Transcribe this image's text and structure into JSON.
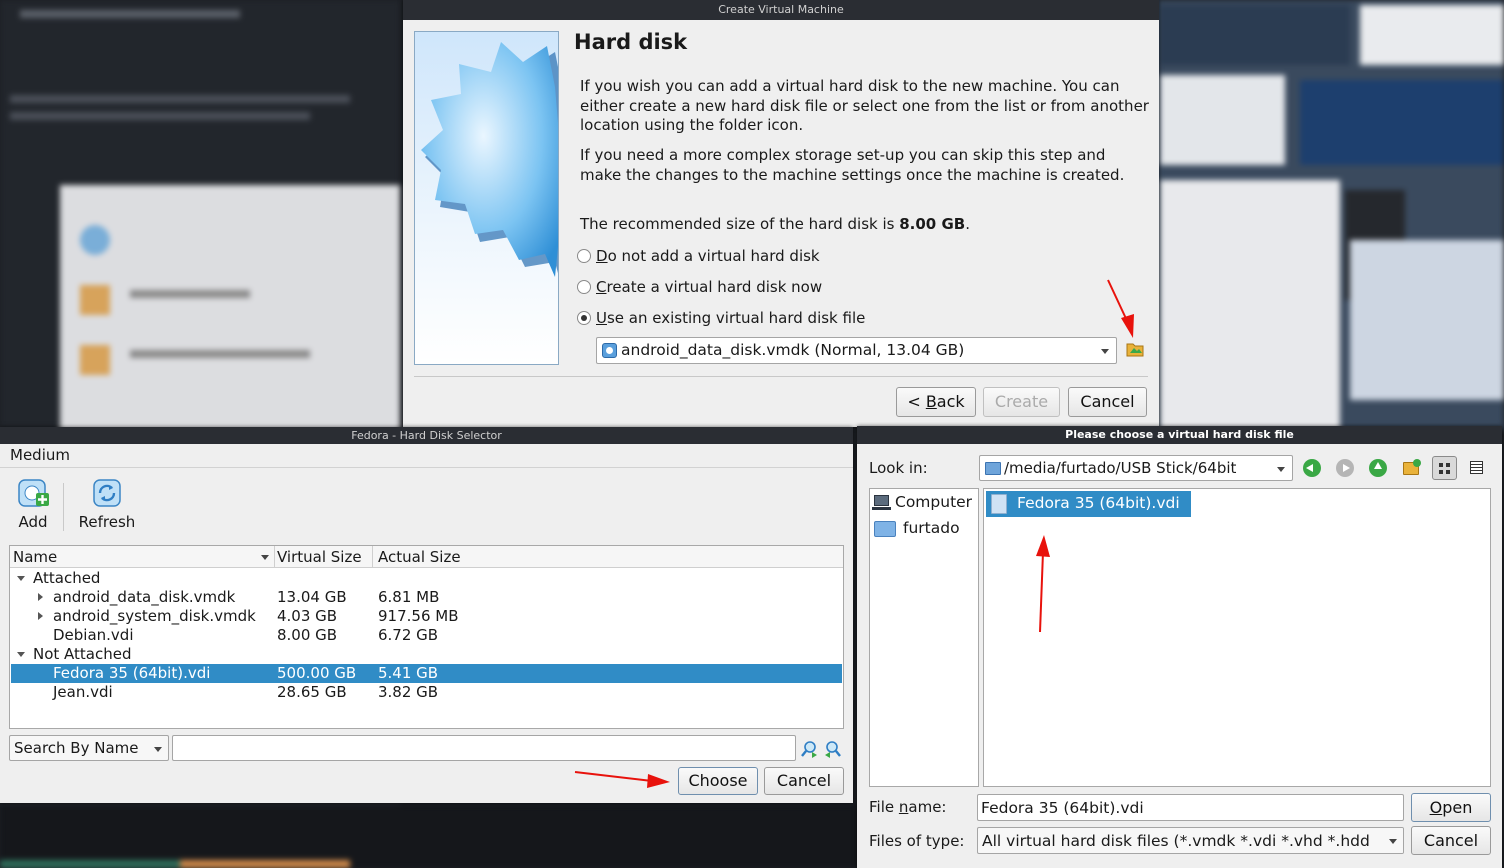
{
  "create_vm": {
    "window_title": "Create Virtual Machine",
    "heading": "Hard disk",
    "para1": "If you wish you can add a virtual hard disk to the new machine. You can either create a new hard disk file or select one from the list or from another location using the folder icon.",
    "para2": "If you need a more complex storage set-up you can skip this step and make the changes to the machine settings once the machine is created.",
    "recommended_prefix": "The recommended size of the hard disk is ",
    "recommended_size": "8.00 GB",
    "recommended_suffix": ".",
    "options": [
      {
        "mnemonic": "D",
        "rest": "o not add a virtual hard disk",
        "selected": false
      },
      {
        "mnemonic": "C",
        "rest": "reate a virtual hard disk now",
        "selected": false
      },
      {
        "mnemonic": "U",
        "rest": "se an existing virtual hard disk file",
        "selected": true
      }
    ],
    "disk_combo_value": "android_data_disk.vmdk (Normal, 13.04 GB)",
    "back_prefix": "< ",
    "back_mnemonic": "B",
    "back_rest": "ack",
    "create_label": "Create",
    "cancel_label": "Cancel"
  },
  "selector": {
    "window_title": "Fedora - Hard Disk Selector",
    "menu_medium": "Medium",
    "toolbar_add": "Add",
    "toolbar_refresh": "Refresh",
    "columns": [
      "Name",
      "Virtual Size",
      "Actual Size"
    ],
    "groups": [
      {
        "label": "Attached",
        "items": [
          {
            "name": "android_data_disk.vmdk",
            "virtual": "13.04 GB",
            "actual": "6.81 MB",
            "expandable": true
          },
          {
            "name": "android_system_disk.vmdk",
            "virtual": "4.03 GB",
            "actual": "917.56 MB",
            "expandable": true
          },
          {
            "name": "Debian.vdi",
            "virtual": "8.00 GB",
            "actual": "6.72 GB",
            "expandable": false
          }
        ]
      },
      {
        "label": "Not Attached",
        "items": [
          {
            "name": "Fedora 35 (64bit).vdi",
            "virtual": "500.00 GB",
            "actual": "5.41 GB",
            "expandable": false,
            "selected": true
          },
          {
            "name": "Jean.vdi",
            "virtual": "28.65 GB",
            "actual": "3.82 GB",
            "expandable": false
          }
        ]
      }
    ],
    "search_mode": "Search By Name",
    "search_value": "",
    "choose_label": "Choose",
    "cancel_label": "Cancel"
  },
  "file_dialog": {
    "window_title": "Please choose a virtual hard disk file",
    "look_in_label": "Look in:",
    "look_in_value": "/media/furtado/USB Stick/64bit",
    "sidebar": [
      "Computer",
      "furtado"
    ],
    "files": [
      "Fedora 35 (64bit).vdi"
    ],
    "file_name_label_prefix": "File ",
    "file_name_label_mnemonic": "n",
    "file_name_label_suffix": "ame:",
    "file_name_value": "Fedora 35 (64bit).vdi",
    "files_of_type_label": "Files of type:",
    "files_of_type_value": "All virtual hard disk files (*.vmdk *.vdi *.vhd *.hdd",
    "open_mnemonic": "O",
    "open_rest": "pen",
    "cancel_label": "Cancel"
  },
  "colors": {
    "selection": "#308cc6",
    "annotation_arrow": "#e8120c",
    "titlebar": "#2a2d33"
  }
}
